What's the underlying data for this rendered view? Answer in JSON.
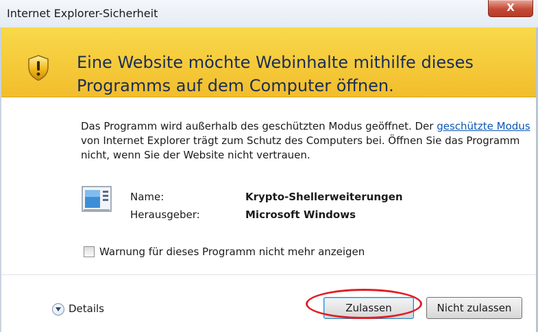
{
  "window": {
    "title": "Internet Explorer-Sicherheit",
    "close_glyph": "X"
  },
  "header": {
    "icon": "shield-warning-icon",
    "text": "Eine Website möchte Webinhalte mithilfe dieses Programms auf dem Computer öffnen.",
    "bg_color": "#f5c93b"
  },
  "description": {
    "part1": "Das Programm wird außerhalb des geschützten Modus geöffnet. Der ",
    "link": "geschützte Modus",
    "part2": " von Internet Explorer trägt zum Schutz des Computers bei. Öffnen Sie das Programm nicht, wenn Sie der Website nicht vertrauen."
  },
  "program": {
    "icon": "program-window-icon",
    "name_label": "Name:",
    "name_value": "Krypto-Shellerweiterungen",
    "publisher_label": "Herausgeber:",
    "publisher_value": "Microsoft Windows"
  },
  "checkbox": {
    "label": "Warnung für dieses Programm nicht mehr anzeigen",
    "checked": false
  },
  "footer": {
    "details_label": "Details",
    "allow_label": "Zulassen",
    "deny_label": "Nicht zulassen",
    "highlight_color": "#e01f26"
  }
}
